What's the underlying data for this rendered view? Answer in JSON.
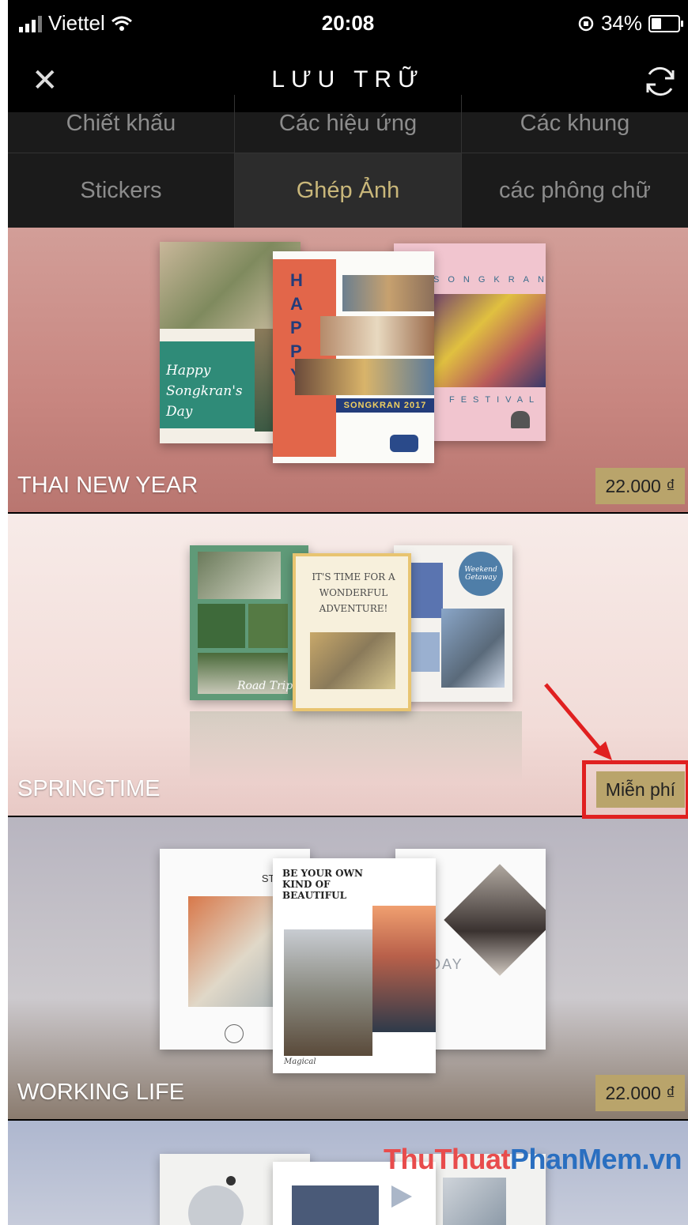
{
  "status": {
    "carrier": "Viettel",
    "time": "20:08",
    "battery": "34%",
    "battery_level": 0.34
  },
  "nav": {
    "close_glyph": "✕",
    "title": "LƯU TRỮ",
    "close_icon": "close-icon",
    "refresh_icon": "refresh-icon"
  },
  "tabs_row1": [
    "Chiết khấu",
    "Các hiệu ứng",
    "Các khung"
  ],
  "tabs_row2": [
    "Stickers",
    "Ghép Ảnh",
    "các phông chữ"
  ],
  "active_tab": "Ghép Ảnh",
  "packs": [
    {
      "name": "THAI NEW YEAR",
      "price": "22.000 ₫",
      "card_text": {
        "greeting": "Happy Songkran's Day",
        "happy": "HAPPY",
        "banner": "SONGKRAN 2017",
        "songkran": "SONGKRAN",
        "festival": "FESTIVAL"
      }
    },
    {
      "name": "SPRINGTIME",
      "price": "Miễn phí",
      "card_text": {
        "adventure": "IT'S TIME FOR A WONDERFUL ADVENTURE!",
        "road": "Road Trip",
        "weekend": "Weekend Getaway"
      }
    },
    {
      "name": "WORKING LIFE",
      "price": "22.000 ₫",
      "card_text": {
        "studio": "STUDIO",
        "quote": "BE YOUR OWN KIND OF BEAUTIFUL",
        "magical": "Magical",
        "day": "DAY"
      }
    },
    {
      "name": "",
      "price": ""
    }
  ],
  "watermark": {
    "part1": "ThuThuat",
    "part2": "PhanMem.vn"
  },
  "colors": {
    "price_badge": "#b9a46b",
    "active_tab": "#c9b77a",
    "highlight": "#e02020"
  }
}
